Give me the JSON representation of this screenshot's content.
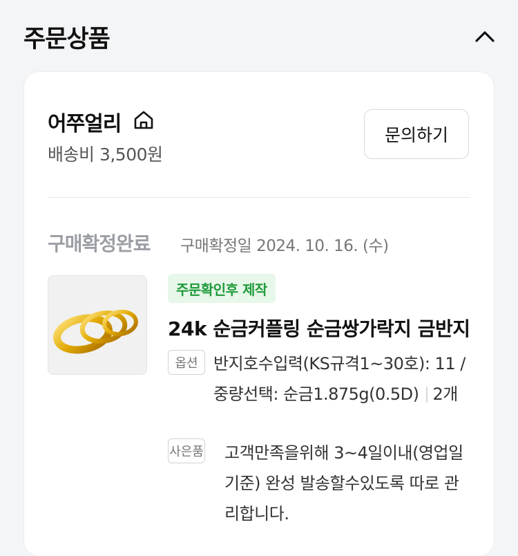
{
  "section_title": "주문상품",
  "store": {
    "name": "어쭈얼리",
    "shipping_fee": "배송비 3,500원",
    "inquiry_button": "문의하기"
  },
  "order": {
    "status": "구매확정완료",
    "confirm_date": "구매확정일 2024. 10. 16. (수)"
  },
  "product": {
    "badge": "주문확인후 제작",
    "name": "24k 순금커플링 순금쌍가락지 금반지",
    "option_tag": "옵션",
    "option_text": "반지호수입력(KS규격1~30호): 11 / 중량선택: 순금1.875g(0.5D)",
    "quantity": "2개",
    "gift_tag": "사은품",
    "gift_text": "고객만족을위해 3~4일이내(영업일기준) 완성 발송할수있도록 따로 관리합니다.",
    "image_icon": "gold-rings-image"
  },
  "colors": {
    "badge_bg": "#e7f7ea",
    "badge_text": "#1f9b3a",
    "status_gray": "#9b9ea4",
    "gold": "#d9a70c"
  }
}
